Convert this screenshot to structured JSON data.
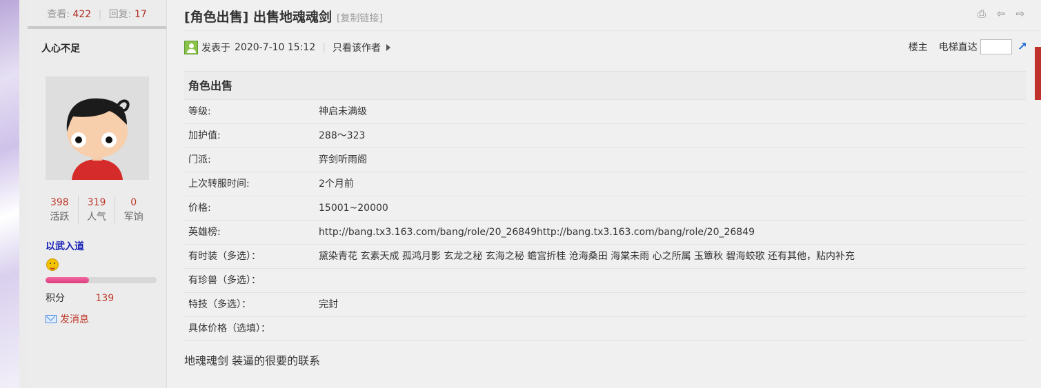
{
  "author": {
    "views_label": "查看:",
    "views": "422",
    "replies_label": "回复:",
    "replies": "17",
    "name": "人心不足",
    "stats": [
      {
        "value": "398",
        "label": "活跃"
      },
      {
        "value": "319",
        "label": "人气"
      },
      {
        "value": "0",
        "label": "军饷"
      }
    ],
    "rank": "以武入道",
    "level_progress": 0.39,
    "score_label": "积分",
    "score": "139",
    "message_label": "发消息"
  },
  "post": {
    "title": "[角色出售] 出售地魂魂剑",
    "copy_link": "[复制链接]",
    "posted_label": "发表于",
    "posted_time": "2020-7-10 15:12",
    "only_author": "只看该作者",
    "floor_owner": "楼主",
    "elevator": "电梯直达",
    "table_title": "角色出售",
    "rows": [
      {
        "k": "等级:",
        "v": "神启未满级"
      },
      {
        "k": "加护值:",
        "v": "288～323"
      },
      {
        "k": "门派:",
        "v": "弈剑听雨阁"
      },
      {
        "k": "上次转服时间:",
        "v": "2个月前"
      },
      {
        "k": "价格:",
        "v": "15001~20000"
      },
      {
        "k": "英雄榜:",
        "v": "http://bang.tx3.163.com/bang/role/20_26849http://bang.tx3.163.com/bang/role/20_26849"
      },
      {
        "k": "有时装（多选）：",
        "v": "黛染青花 玄素天成 孤鸿月影 玄龙之秘 玄海之秘 蟾宫折桂 沧海桑田 海棠未雨 心之所属 玉簟秋 碧海蛟歌 还有其他，贴内补充"
      },
      {
        "k": "有珍兽（多选）：",
        "v": ""
      },
      {
        "k": "特技（多选）：",
        "v": "完封"
      },
      {
        "k": "具体价格（选填）：",
        "v": ""
      }
    ],
    "body": "地魂魂剑 装逼的很要的联系"
  },
  "colors": {
    "accent_red": "#c0392b",
    "rank_blue": "#1a22b8",
    "progress_pink": "#e0508c"
  },
  "icons": [
    "print-icon",
    "prev-icon",
    "next-icon",
    "user-icon",
    "mail-icon",
    "elevator-icon",
    "smiley-icon"
  ]
}
